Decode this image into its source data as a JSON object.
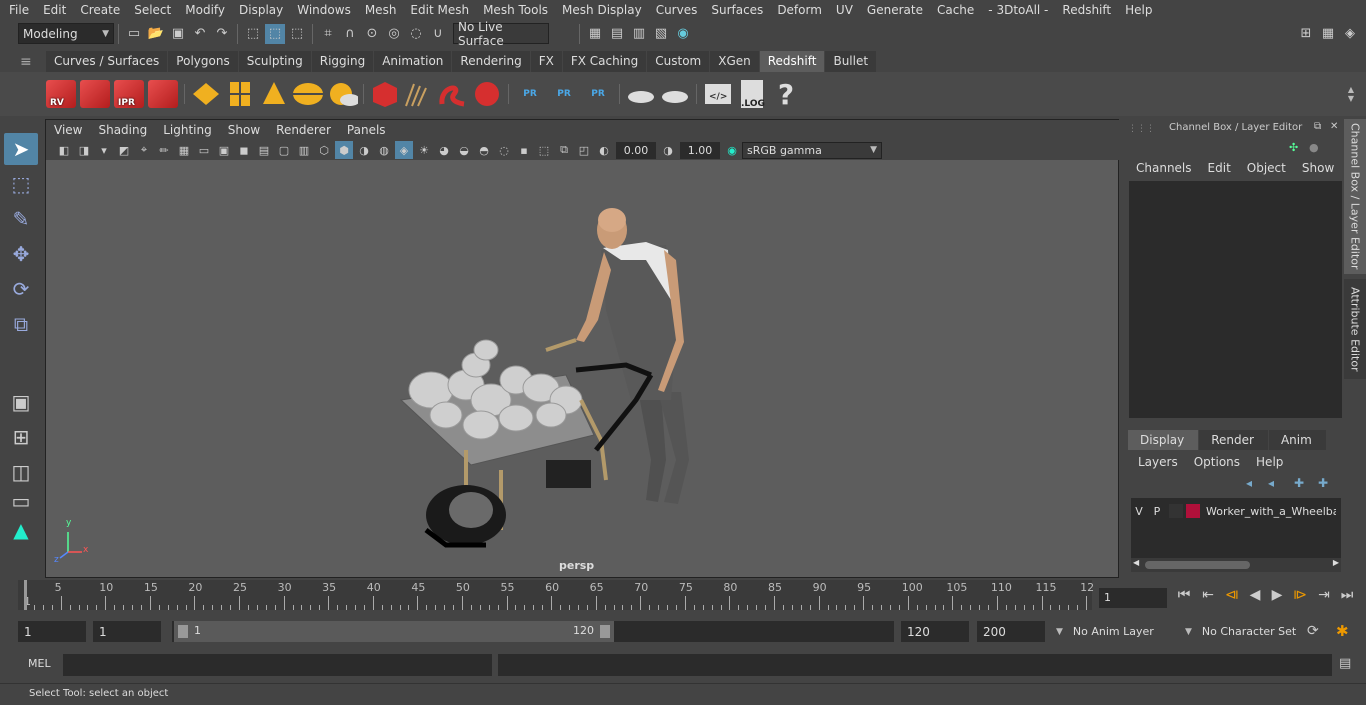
{
  "menu": [
    "File",
    "Edit",
    "Create",
    "Select",
    "Modify",
    "Display",
    "Windows",
    "Mesh",
    "Edit Mesh",
    "Mesh Tools",
    "Mesh Display",
    "Curves",
    "Surfaces",
    "Deform",
    "UV",
    "Generate",
    "Cache",
    "- 3DtoAll -",
    "Redshift",
    "Help"
  ],
  "status": {
    "mode": "Modeling",
    "live_surface": "No Live Surface"
  },
  "shelf_tabs": [
    "Curves / Surfaces",
    "Polygons",
    "Sculpting",
    "Rigging",
    "Animation",
    "Rendering",
    "FX",
    "FX Caching",
    "Custom",
    "XGen",
    "Redshift",
    "Bullet"
  ],
  "shelf_active": "Redshift",
  "shelf_icons": {
    "rv": "RV",
    "ipr": "IPR",
    "pr": "PR",
    "log": ".LOG",
    "help": "?"
  },
  "viewport": {
    "menu": [
      "View",
      "Shading",
      "Lighting",
      "Show",
      "Renderer",
      "Panels"
    ],
    "exposure": "0.00",
    "gamma": "1.00",
    "colorspace": "sRGB gamma",
    "camera": "persp",
    "axis": {
      "x": "x",
      "y": "y",
      "z": "z"
    }
  },
  "channel_box": {
    "title": "Channel Box / Layer Editor",
    "menu": [
      "Channels",
      "Edit",
      "Object",
      "Show"
    ]
  },
  "layer_editor": {
    "tabs": [
      "Display",
      "Render",
      "Anim"
    ],
    "active_tab": "Display",
    "menu": [
      "Layers",
      "Options",
      "Help"
    ],
    "layer": {
      "v": "V",
      "p": "P",
      "name": "Worker_with_a_Wheelbarrow",
      "color": "#b0103a"
    }
  },
  "side_tabs": [
    "Channel Box / Layer Editor",
    "Attribute Editor"
  ],
  "timeline": {
    "ticks": [
      "5",
      "10",
      "15",
      "20",
      "25",
      "30",
      "35",
      "40",
      "45",
      "50",
      "55",
      "60",
      "65",
      "70",
      "75",
      "80",
      "85",
      "90",
      "95",
      "100",
      "105",
      "110",
      "115",
      "12"
    ],
    "start_marker": "1",
    "current_frame": "1"
  },
  "range": {
    "start": "1",
    "playback_start": "1",
    "slider_start": "1",
    "slider_end": "120",
    "playback_end": "120",
    "end": "200",
    "anim_layer": "No Anim Layer",
    "character_set": "No Character Set"
  },
  "command": {
    "label": "MEL"
  },
  "help_text": "Select Tool: select an object",
  "colors": {
    "accent": "#5285a6",
    "redshift": "#d62f2f",
    "yellow": "#f0b020"
  }
}
